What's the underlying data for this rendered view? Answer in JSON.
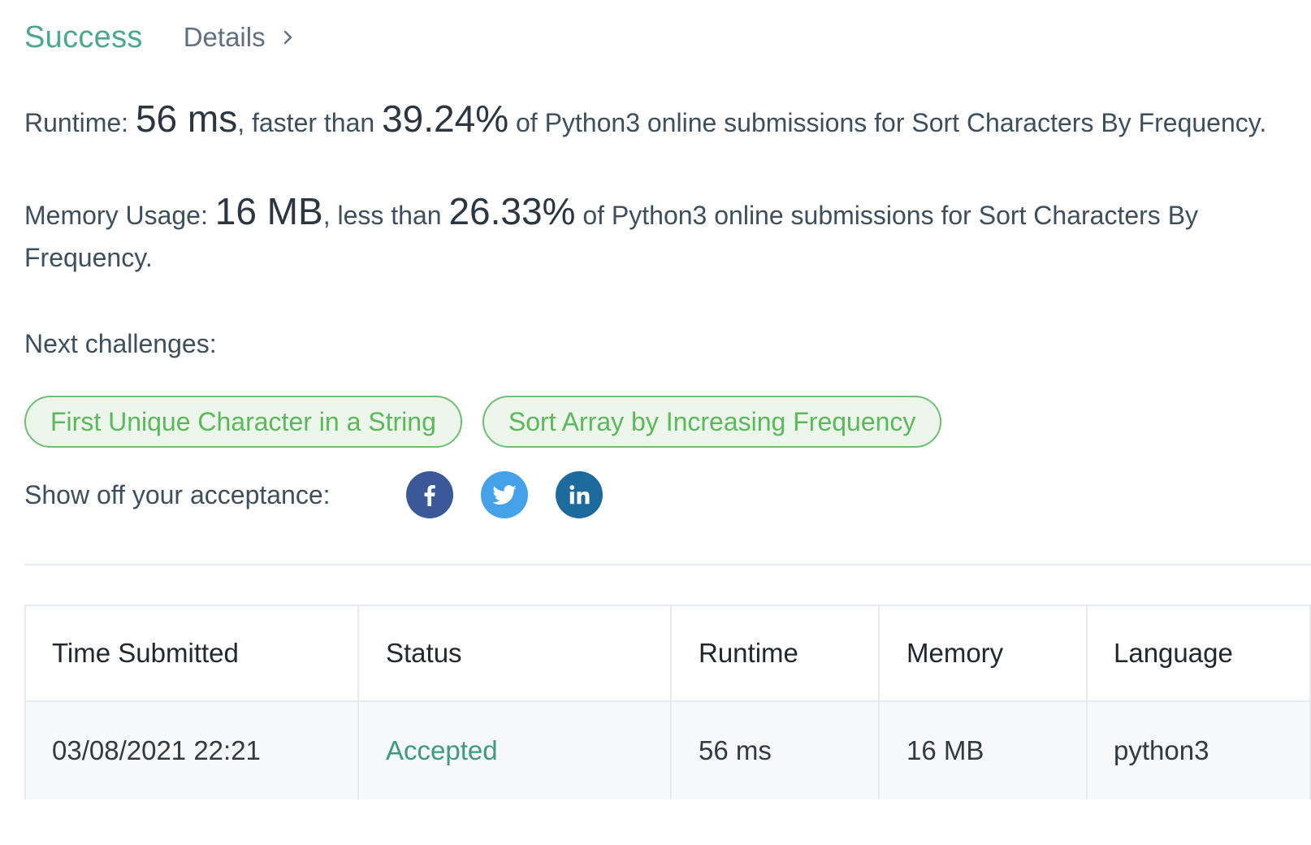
{
  "header": {
    "status": "Success",
    "details_label": "Details"
  },
  "runtime": {
    "prefix": "Runtime: ",
    "value": "56 ms",
    "middle": ", faster than ",
    "percent": "39.24%",
    "suffix": " of Python3 online submissions for Sort Characters By Frequency."
  },
  "memory": {
    "prefix": "Memory Usage: ",
    "value": "16 MB",
    "middle": ", less than ",
    "percent": "26.33%",
    "suffix": " of Python3 online submissions for Sort Characters By Frequency."
  },
  "next": {
    "label": "Next challenges:",
    "challenges": [
      "First Unique Character in a String",
      "Sort Array by Increasing Frequency"
    ]
  },
  "share": {
    "label": "Show off your acceptance:",
    "icons": [
      "facebook-icon",
      "twitter-icon",
      "linkedin-icon"
    ],
    "colors": {
      "facebook": "#3b5998",
      "twitter": "#45a2e8",
      "linkedin": "#1d6a9c"
    }
  },
  "table": {
    "headers": [
      "Time Submitted",
      "Status",
      "Runtime",
      "Memory",
      "Language"
    ],
    "rows": [
      [
        "03/08/2021 22:21",
        "Accepted",
        "56 ms",
        "16 MB",
        "python3"
      ]
    ]
  },
  "colors": {
    "success": "#4aa88c",
    "chip_border": "#6fbf73",
    "chip_bg": "#ecf6ea",
    "chip_text": "#5cb85c",
    "accepted": "#3e9b7f"
  }
}
